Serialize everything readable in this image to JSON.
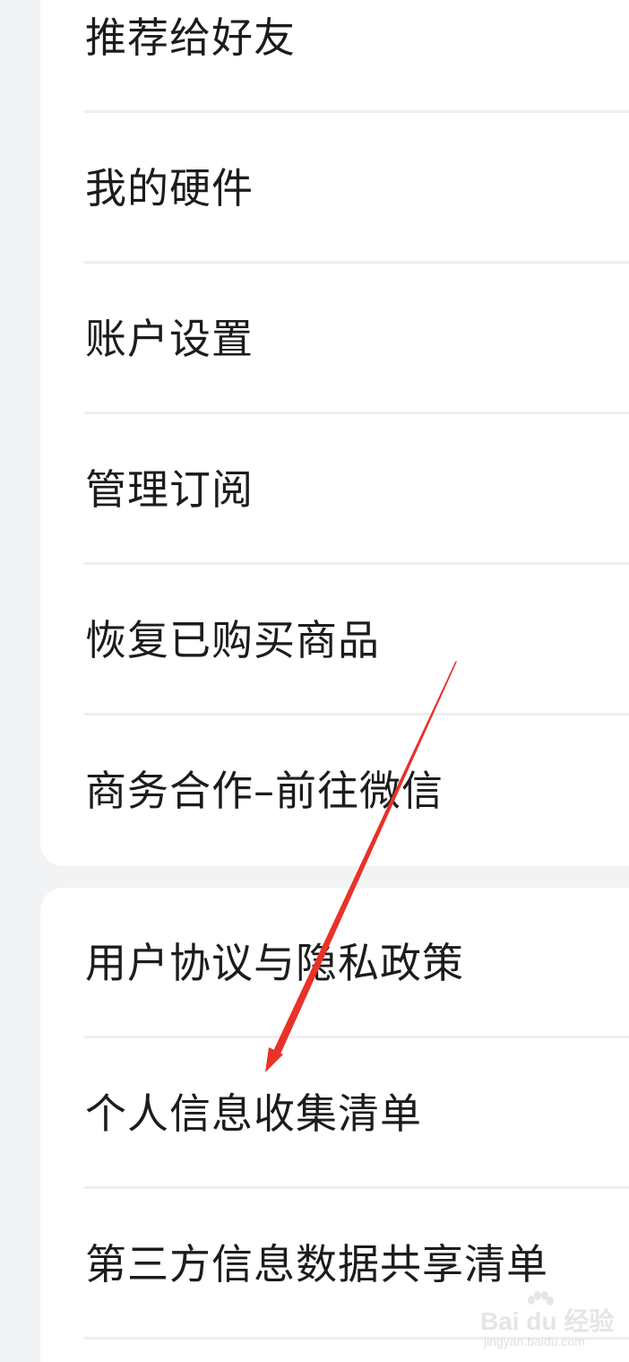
{
  "menu_group_1": {
    "items": [
      {
        "label": "推荐给好友"
      },
      {
        "label": "我的硬件"
      },
      {
        "label": "账户设置"
      },
      {
        "label": "管理订阅"
      },
      {
        "label": "恢复已购买商品"
      },
      {
        "label": "商务合作–前往微信"
      }
    ]
  },
  "menu_group_2": {
    "items": [
      {
        "label": "用户协议与隐私政策"
      },
      {
        "label": "个人信息收集清单"
      },
      {
        "label": "第三方信息数据共享清单"
      }
    ]
  },
  "annotation": {
    "arrow_color": "#e8322a",
    "arrow_icon": "red-arrow-icon"
  },
  "watermark": {
    "main_text": "Bai du 经验",
    "sub_text": "jingyan.baidu.com"
  }
}
